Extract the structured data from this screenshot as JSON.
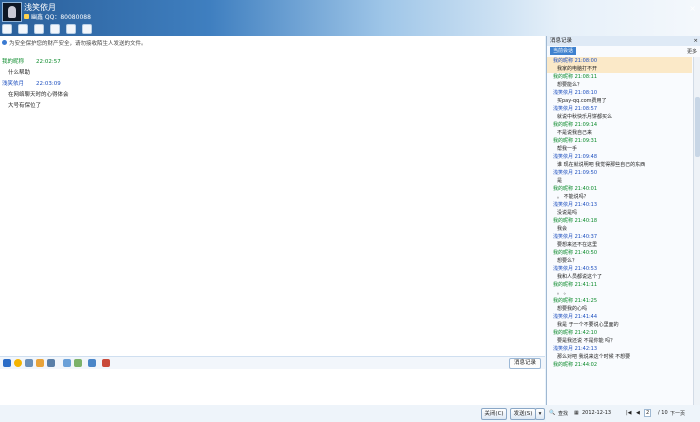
{
  "header": {
    "contact_name": "浅笑依月",
    "status_text": "幽鑫 QQ：80080088",
    "close_label": "×"
  },
  "notice": "为安全保护您的财产安全，请勿接收陌生人发送的文件。",
  "messages": [
    {
      "sender": "我的昵称",
      "time": "22:02:57",
      "role": "me",
      "lines": [
        "什么帮助"
      ]
    },
    {
      "sender": "浅笑依月",
      "time": "22:03:09",
      "role": "peer",
      "lines": [
        "在网络聊天时的心得体会",
        "大号有保位了"
      ]
    }
  ],
  "format_bar": {
    "history_toggle_label": "消息记录"
  },
  "buttons": {
    "close": "关闭(C)",
    "send": "发送(S)",
    "send_dropdown": "▾"
  },
  "history": {
    "title": "消息记录",
    "tab": "当前会话",
    "more": "更多",
    "items": [
      {
        "type": "meta",
        "role": "peer",
        "text": "我的昵称 21:08:00"
      },
      {
        "type": "text",
        "text": "我家的电脑打不开"
      },
      {
        "type": "meta",
        "role": "me",
        "text": "我的昵称 21:08:11"
      },
      {
        "type": "text",
        "text": "想要能么？"
      },
      {
        "type": "meta",
        "role": "peer",
        "text": "浅笑依月 21:08:10"
      },
      {
        "type": "text",
        "text": "买pay-qq.com费用了"
      },
      {
        "type": "meta",
        "role": "peer",
        "text": "浅笑依月 21:08:57"
      },
      {
        "type": "text",
        "text": "就说中秋快乐月饼都买么"
      },
      {
        "type": "meta",
        "role": "me",
        "text": "我的昵称 21:09:14"
      },
      {
        "type": "text",
        "text": "不是说我自己来"
      },
      {
        "type": "meta",
        "role": "me",
        "text": "我的昵称 21:09:31"
      },
      {
        "type": "text",
        "text": "帮我一手"
      },
      {
        "type": "meta",
        "role": "peer",
        "text": "浅笑依月 21:09:48"
      },
      {
        "type": "text",
        "text": "谁 现在就说明吧 我觉得那些自己的东西"
      },
      {
        "type": "meta",
        "role": "peer",
        "text": "浅笑依月 21:09:50"
      },
      {
        "type": "text",
        "text": "是"
      },
      {
        "type": "meta",
        "role": "me",
        "text": "我的昵称 21:40:01"
      },
      {
        "type": "text",
        "text": "。 不能说吗？"
      },
      {
        "type": "meta",
        "role": "peer",
        "text": "浅笑依月 21:40:13"
      },
      {
        "type": "text",
        "text": "没说是吗"
      },
      {
        "type": "meta",
        "role": "me",
        "text": "我的昵称 21:40:18"
      },
      {
        "type": "text",
        "text": "我会"
      },
      {
        "type": "meta",
        "role": "peer",
        "text": "浅笑依月 21:40:37"
      },
      {
        "type": "text",
        "text": "要想来还不在这里"
      },
      {
        "type": "meta",
        "role": "me",
        "text": "我的昵称 21:40:50"
      },
      {
        "type": "text",
        "text": "想要么？"
      },
      {
        "type": "meta",
        "role": "peer",
        "text": "浅笑依月 21:40:53"
      },
      {
        "type": "text",
        "text": "我和人员都说这个了"
      },
      {
        "type": "meta",
        "role": "me",
        "text": "我的昵称 21:41:11"
      },
      {
        "type": "text",
        "text": "。 。"
      },
      {
        "type": "meta",
        "role": "me",
        "text": "我的昵称 21:41:25"
      },
      {
        "type": "text",
        "text": "想要我的心吗"
      },
      {
        "type": "meta",
        "role": "peer",
        "text": "浅笑依月 21:41:44"
      },
      {
        "type": "text",
        "text": "我是 于一个不要说心里面的"
      },
      {
        "type": "meta",
        "role": "me",
        "text": "我的昵称 21:42:10"
      },
      {
        "type": "text",
        "text": "要是我还说 不是你能 吗？"
      },
      {
        "type": "meta",
        "role": "peer",
        "text": "浅笑依月 21:42:13"
      },
      {
        "type": "text",
        "text": "那么对吧 我说来这个时候 不想要"
      },
      {
        "type": "meta",
        "role": "me",
        "text": "我的昵称 21:44:02"
      }
    ],
    "footer": {
      "search_label": "查找",
      "date": "2012-12-13",
      "page": "2",
      "page_total": "/ 10",
      "next_label": "下一页"
    }
  },
  "colors": {
    "accent": "#3f82cf",
    "me": "#0a8a2a",
    "peer": "#1d4fbf"
  }
}
